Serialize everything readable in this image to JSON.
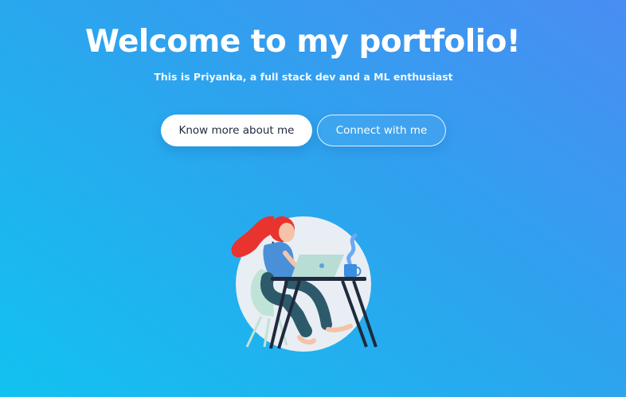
{
  "hero": {
    "title": "Welcome to my portfolio!",
    "subtitle": "This is Priyanka, a full stack dev and a ML enthusiast",
    "primary_button_label": "Know more about me",
    "secondary_button_label": "Connect with me"
  },
  "illustration": {
    "icon": "woman-working-at-laptop-illustration"
  },
  "colors": {
    "gradient_top_right": "#4a8df2",
    "gradient_bottom_left": "#12c2f0",
    "text": "#ffffff",
    "primary_button_bg": "#ffffff",
    "primary_button_text": "#1f2a3d"
  }
}
